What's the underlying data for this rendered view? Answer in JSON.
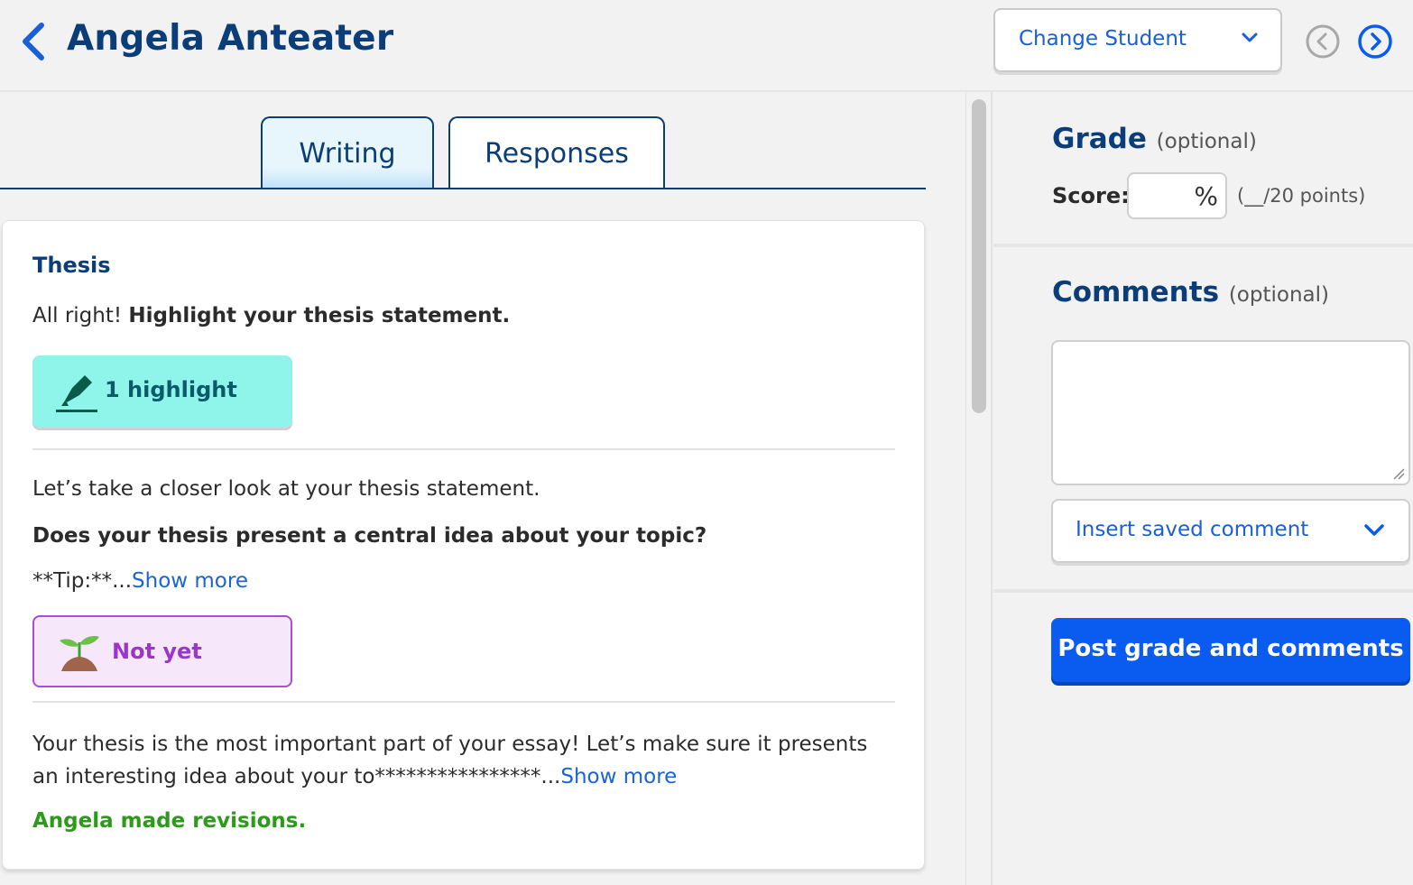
{
  "header": {
    "student_name": "Angela Anteater",
    "change_student_label": "Change Student"
  },
  "tabs": [
    {
      "label": "Writing",
      "active": true
    },
    {
      "label": "Responses",
      "active": false
    }
  ],
  "card": {
    "section_title": "Thesis",
    "prompt_prefix": "All right! ",
    "prompt_bold": "Highlight your thesis statement.",
    "highlight_label": "1 highlight",
    "closer_look": "Let’s take a closer look at your thesis statement.",
    "question": "Does your thesis present a central idea about your topic?",
    "tip_text": "**Tip:**...",
    "show_more": "Show more",
    "status_label": "Not yet",
    "feedback_text": "Your thesis is the most important part of your essay! Let’s make sure it presents an interesting idea about your to****************...",
    "feedback_show_more": "Show more",
    "revisions": "Angela made revisions."
  },
  "grade": {
    "title": "Grade",
    "optional": "(optional)",
    "score_label": "Score:",
    "score_value": "",
    "percent_symbol": "%",
    "points_hint": "(__/20 points)"
  },
  "comments": {
    "title": "Comments",
    "optional": "(optional)",
    "comment_value": "",
    "saved_comment_label": "Insert saved comment",
    "post_label": "Post grade and comments"
  },
  "colors": {
    "brand_navy": "#0b3e79",
    "link_blue": "#1a63d8",
    "primary_button": "#0a5cf0",
    "highlight_teal": "#8ff5ea",
    "not_yet_purple": "#9a36c9",
    "success_green": "#2c9b19"
  }
}
